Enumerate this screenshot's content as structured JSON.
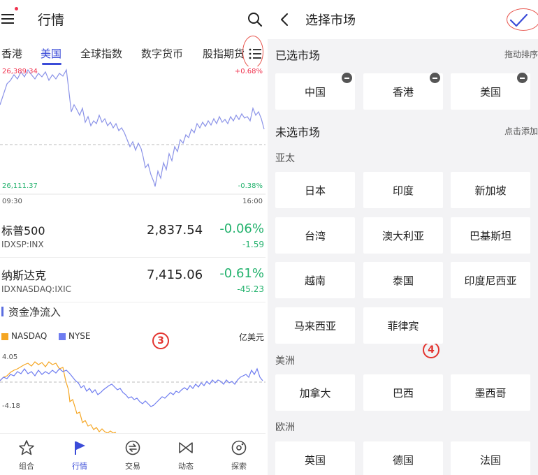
{
  "left": {
    "title": "行情",
    "tabs": [
      "香港",
      "美国",
      "全球指数",
      "数字货币",
      "股指期货"
    ],
    "active_tab": "美国",
    "chart": {
      "high_label": "26,389.34",
      "high_pct": "+0.68%",
      "low_label": "26,111.37",
      "low_pct": "-0.38%",
      "start_time": "09:30",
      "end_time": "16:00"
    },
    "stocks": [
      {
        "name": "标普500",
        "code": "IDXSP:INX",
        "price": "2,837.54",
        "pct": "-0.06%",
        "change": "-1.59"
      },
      {
        "name": "纳斯达克",
        "code": "IDXNASDAQ:IXIC",
        "price": "7,415.06",
        "pct": "-0.61%",
        "change": "-45.23"
      }
    ],
    "flow": {
      "title": "资金净流入",
      "legend": [
        "NASDAQ",
        "NYSE"
      ],
      "unit": "亿美元",
      "max_label": "4.05",
      "min_label": "-4.18"
    },
    "step_badge": "3",
    "nav": [
      {
        "label": "组合",
        "icon": "star-icon"
      },
      {
        "label": "行情",
        "icon": "flag-icon"
      },
      {
        "label": "交易",
        "icon": "trade-icon"
      },
      {
        "label": "动态",
        "icon": "bowtie-icon"
      },
      {
        "label": "探索",
        "icon": "explore-icon"
      }
    ]
  },
  "right": {
    "title": "选择市场",
    "selected_title": "已选市场",
    "selected_hint": "拖动排序",
    "selected": [
      "中国",
      "香港",
      "美国"
    ],
    "unselected_title": "未选市场",
    "unselected_hint": "点击添加",
    "groups": [
      {
        "name": "亚太",
        "items": [
          "日本",
          "印度",
          "新加坡",
          "台湾",
          "澳大利亚",
          "巴基斯坦",
          "越南",
          "泰国",
          "印度尼西亚",
          "马来西亚",
          "菲律宾"
        ]
      },
      {
        "name": "美洲",
        "items": [
          "加拿大",
          "巴西",
          "墨西哥"
        ]
      },
      {
        "name": "欧洲",
        "items": [
          "英国",
          "德国",
          "法国"
        ]
      }
    ],
    "step_badge": "4"
  },
  "colors": {
    "accent": "#3b4cd8",
    "up": "#f0334f",
    "down": "#23b26d",
    "nasdaq": "#f5a623",
    "nyse": "#6e7cf0",
    "index_line": "#8b93e8",
    "annotation": "#e8574f"
  }
}
